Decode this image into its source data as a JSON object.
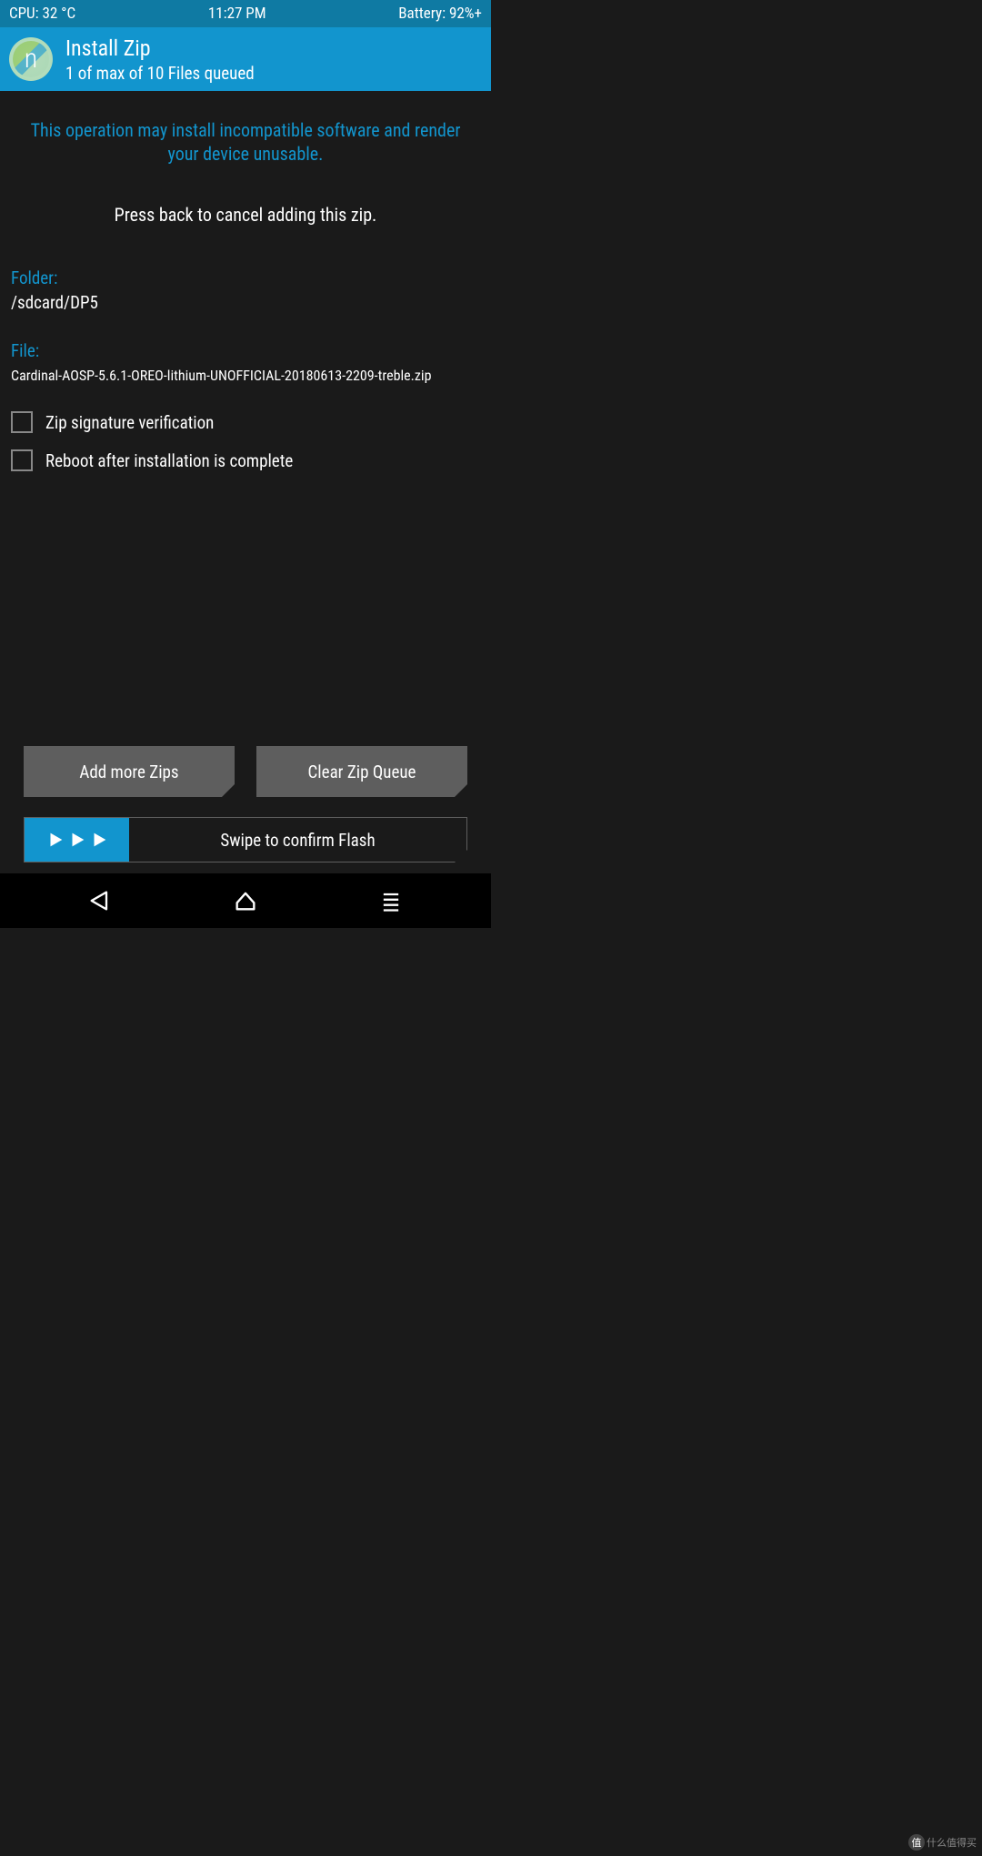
{
  "status_bar": {
    "cpu": "CPU: 32 °C",
    "time": "11:27 PM",
    "battery": "Battery: 92%+"
  },
  "header": {
    "logo_letter": "n",
    "title": "Install Zip",
    "subtitle": "1 of max of 10 Files queued"
  },
  "warning": "This operation may install incompatible software and render your device unusable.",
  "instruction": "Press back to cancel adding this zip.",
  "folder": {
    "label": "Folder:",
    "value": "/sdcard/DP5"
  },
  "file": {
    "label": "File:",
    "value": "Cardinal-AOSP-5.6.1-OREO-lithium-UNOFFICIAL-20180613-2209-treble.zip"
  },
  "checkboxes": {
    "zip_verify": {
      "label": "Zip signature verification",
      "checked": false
    },
    "reboot_after": {
      "label": "Reboot after installation is complete",
      "checked": false
    }
  },
  "buttons": {
    "add_more": "Add more Zips",
    "clear_queue": "Clear Zip Queue"
  },
  "swipe": {
    "label": "Swipe to confirm Flash"
  },
  "watermark": {
    "badge": "值",
    "text": "什么值得买"
  }
}
